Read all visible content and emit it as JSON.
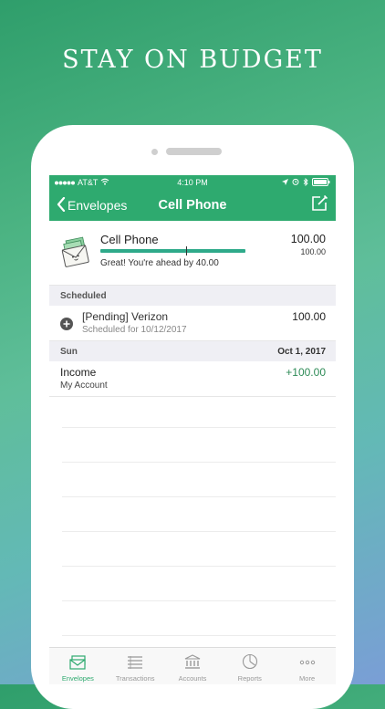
{
  "headline": "STAY ON BUDGET",
  "status_bar": {
    "carrier": "AT&T",
    "time": "4:10 PM"
  },
  "nav": {
    "back_label": "Envelopes",
    "title": "Cell Phone"
  },
  "envelope": {
    "name": "Cell Phone",
    "amount": "100.00",
    "budget": "100.00",
    "note": "Great! You're ahead by 40.00",
    "progress_fraction": 1.0,
    "bar_color": "#2eaa8a"
  },
  "scheduled_section": {
    "label": "Scheduled",
    "items": [
      {
        "title": "[Pending] Verizon",
        "subtitle": "Scheduled for 10/12/2017",
        "amount": "100.00",
        "icon": "plus-circle-icon"
      }
    ]
  },
  "date_section": {
    "day": "Sun",
    "date": "Oct 1, 2017"
  },
  "transactions": [
    {
      "title": "Income",
      "account": "My Account",
      "amount": "+100.00",
      "amount_color": "#2e8b57"
    }
  ],
  "tabs": [
    {
      "label": "Envelopes",
      "icon": "envelopes-icon",
      "active": true
    },
    {
      "label": "Transactions",
      "icon": "transactions-icon",
      "active": false
    },
    {
      "label": "Accounts",
      "icon": "accounts-icon",
      "active": false
    },
    {
      "label": "Reports",
      "icon": "reports-icon",
      "active": false
    },
    {
      "label": "More",
      "icon": "more-icon",
      "active": false
    }
  ],
  "colors": {
    "accent": "#2eaa6f",
    "positive_amount": "#2e8b57",
    "section_bg": "#efeff4"
  }
}
